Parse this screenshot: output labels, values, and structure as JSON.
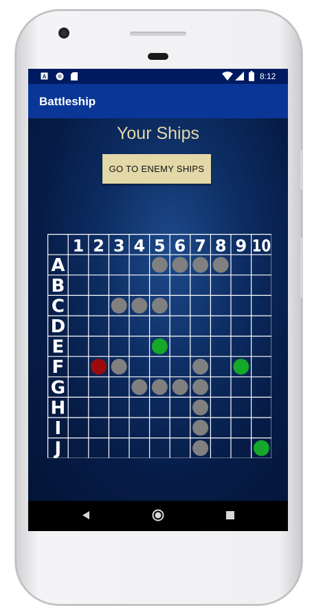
{
  "status_bar": {
    "time": "8:12",
    "left_icons": [
      "a-badge-icon",
      "circle-notification-icon",
      "sd-card-icon"
    ],
    "right_icons": [
      "wifi-icon",
      "signal-icon",
      "battery-icon"
    ]
  },
  "app_bar": {
    "title": "Battleship"
  },
  "screen": {
    "heading": "Your Ships",
    "go_button_label": "GO TO ENEMY SHIPS"
  },
  "board": {
    "columns": [
      "1",
      "2",
      "3",
      "4",
      "5",
      "6",
      "7",
      "8",
      "9",
      "10"
    ],
    "rows": [
      "A",
      "B",
      "C",
      "D",
      "E",
      "F",
      "G",
      "H",
      "I",
      "J"
    ],
    "colors": {
      "ship": "#808080",
      "hit": "#9b0b0b",
      "miss": "#16a82a",
      "grid": "#ffffff"
    },
    "markers": [
      {
        "row": "A",
        "col": 5,
        "state": "ship"
      },
      {
        "row": "A",
        "col": 6,
        "state": "ship"
      },
      {
        "row": "A",
        "col": 7,
        "state": "ship"
      },
      {
        "row": "A",
        "col": 8,
        "state": "ship"
      },
      {
        "row": "C",
        "col": 3,
        "state": "ship"
      },
      {
        "row": "C",
        "col": 4,
        "state": "ship"
      },
      {
        "row": "C",
        "col": 5,
        "state": "ship"
      },
      {
        "row": "E",
        "col": 5,
        "state": "miss"
      },
      {
        "row": "F",
        "col": 2,
        "state": "hit"
      },
      {
        "row": "F",
        "col": 3,
        "state": "ship"
      },
      {
        "row": "F",
        "col": 7,
        "state": "ship"
      },
      {
        "row": "F",
        "col": 9,
        "state": "miss"
      },
      {
        "row": "G",
        "col": 4,
        "state": "ship"
      },
      {
        "row": "G",
        "col": 5,
        "state": "ship"
      },
      {
        "row": "G",
        "col": 6,
        "state": "ship"
      },
      {
        "row": "G",
        "col": 7,
        "state": "ship"
      },
      {
        "row": "H",
        "col": 7,
        "state": "ship"
      },
      {
        "row": "I",
        "col": 7,
        "state": "ship"
      },
      {
        "row": "J",
        "col": 7,
        "state": "ship"
      },
      {
        "row": "J",
        "col": 10,
        "state": "miss"
      }
    ]
  },
  "nav_bar": {
    "icons": [
      "back-icon",
      "home-icon",
      "recents-icon"
    ]
  }
}
